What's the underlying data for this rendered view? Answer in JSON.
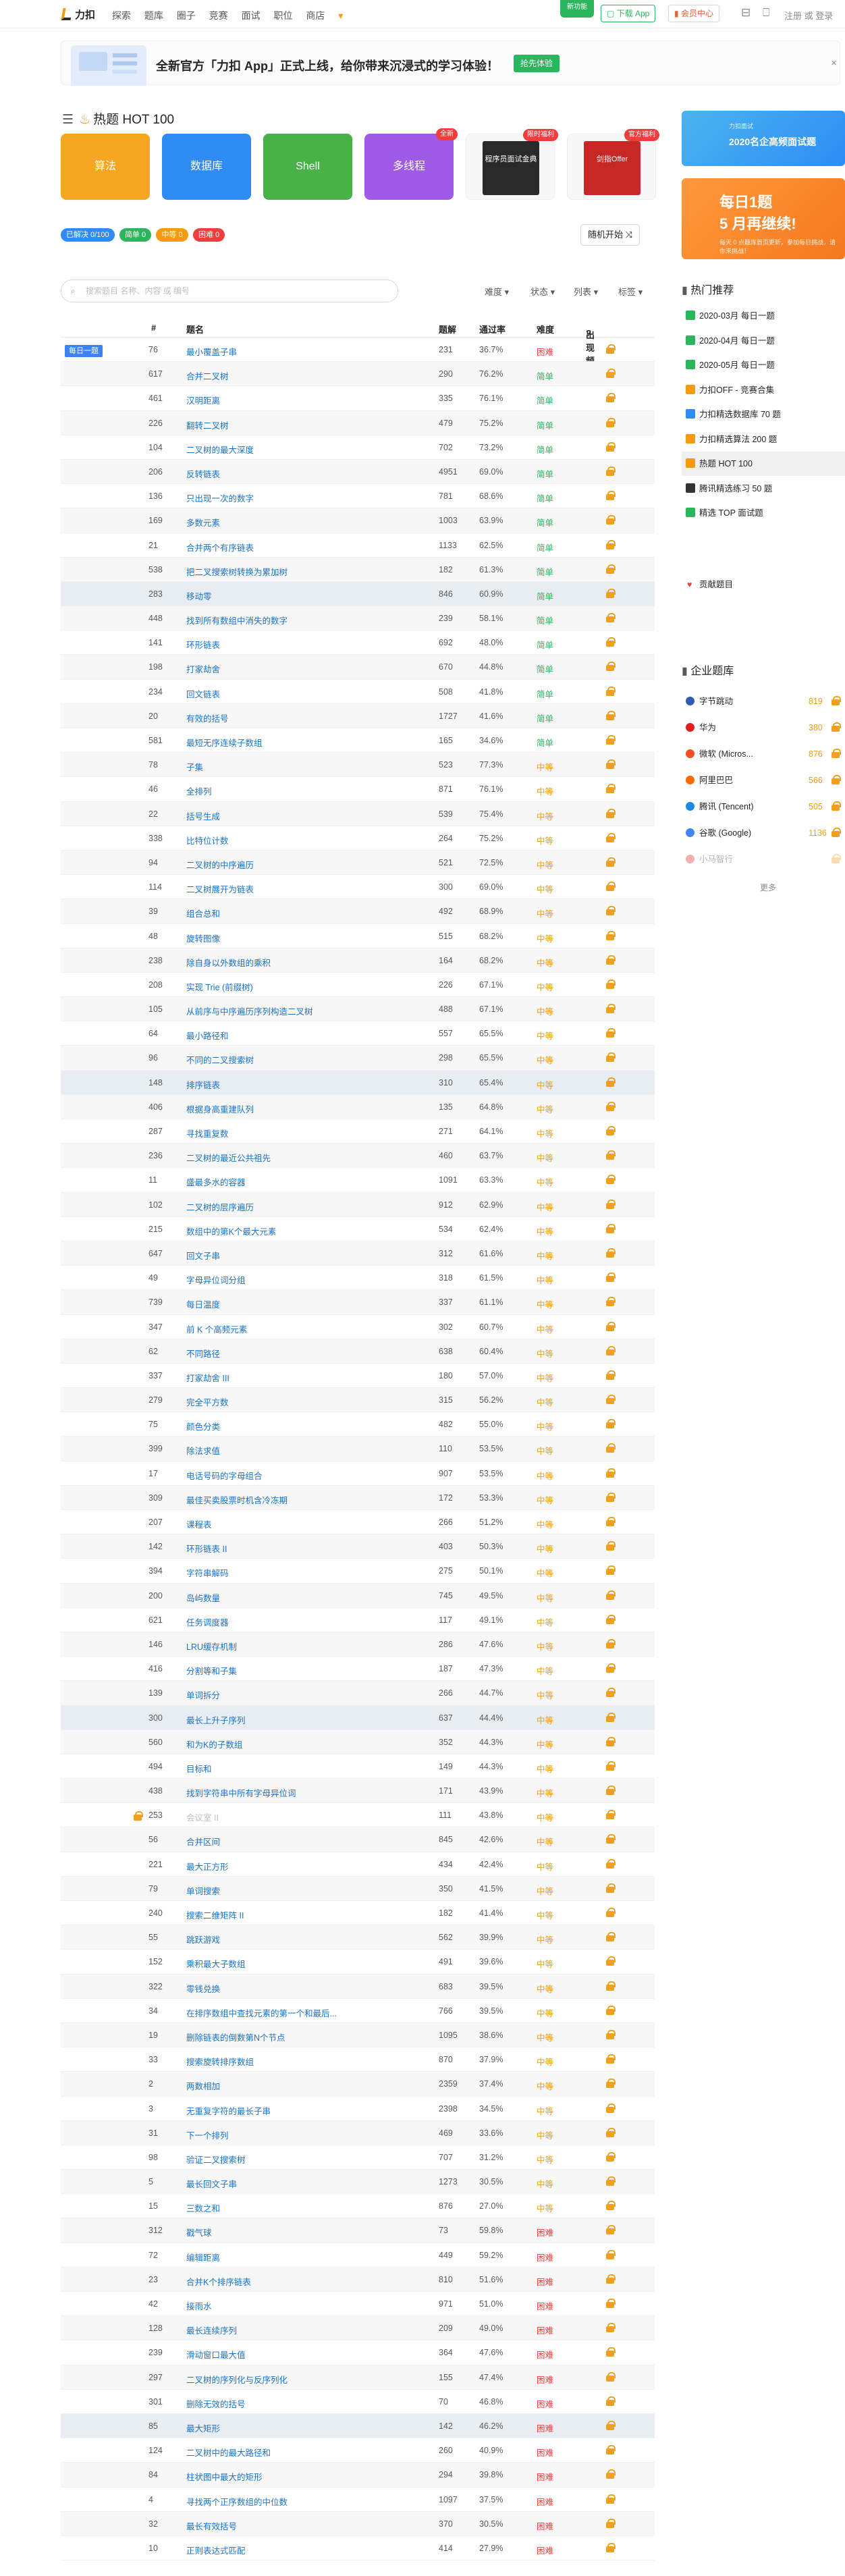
{
  "nav": {
    "logo": "力扣",
    "links": [
      "探索",
      "题库",
      "圈子",
      "竞赛",
      "面试",
      "职位",
      "商店"
    ],
    "new_badge": "新功能",
    "download_btn": "下载 App",
    "vip_btn": "会员中心",
    "register": "注册",
    "or": "或",
    "login": "登录"
  },
  "banner": {
    "text": "全新官方「力扣 App」正式上线，给你带来沉浸式的学习体验！",
    "button": "抢先体验",
    "close": "×"
  },
  "page_title": "热题 HOT 100",
  "categories": [
    {
      "label": "算法",
      "color": "#f5a623"
    },
    {
      "label": "数据库",
      "color": "#2f8cf4"
    },
    {
      "label": "Shell",
      "color": "#48b147"
    },
    {
      "label": "多线程",
      "color": "#a05be6",
      "tag": "全新"
    },
    {
      "label": "程序员面试金典",
      "color": "#f7f7f7",
      "tag": "限时福利",
      "cover": "程序员面试金典"
    },
    {
      "label": "剑指 Offer",
      "color": "#f7f7f7",
      "tag": "官方福利",
      "cover": "剑指Offer"
    }
  ],
  "stats": {
    "solved": "已解决 0/100",
    "easy": "简单 0",
    "medium": "中等 0",
    "hard": "困难 0"
  },
  "random_btn": "随机开始",
  "search_placeholder": "搜索题目 名称、内容 或 编号",
  "filters": [
    "难度",
    "状态",
    "列表",
    "标签"
  ],
  "table_headers": {
    "no": "#",
    "title": "题名",
    "solutions": "题解",
    "rate": "通过率",
    "difficulty": "难度",
    "frequency": "出现频率"
  },
  "daily_label": "每日一题",
  "problems": [
    {
      "no": "76",
      "title": "最小覆盖子串",
      "sol": "231",
      "rate": "36.7%",
      "diff": "困难"
    },
    {
      "no": "617",
      "title": "合并二叉树",
      "sol": "290",
      "rate": "76.2%",
      "diff": "简单"
    },
    {
      "no": "461",
      "title": "汉明距离",
      "sol": "335",
      "rate": "76.1%",
      "diff": "简单"
    },
    {
      "no": "226",
      "title": "翻转二叉树",
      "sol": "479",
      "rate": "75.2%",
      "diff": "简单"
    },
    {
      "no": "104",
      "title": "二叉树的最大深度",
      "sol": "702",
      "rate": "73.2%",
      "diff": "简单"
    },
    {
      "no": "206",
      "title": "反转链表",
      "sol": "4951",
      "rate": "69.0%",
      "diff": "简单"
    },
    {
      "no": "136",
      "title": "只出现一次的数字",
      "sol": "781",
      "rate": "68.6%",
      "diff": "简单"
    },
    {
      "no": "169",
      "title": "多数元素",
      "sol": "1003",
      "rate": "63.9%",
      "diff": "简单"
    },
    {
      "no": "21",
      "title": "合并两个有序链表",
      "sol": "1133",
      "rate": "62.5%",
      "diff": "简单"
    },
    {
      "no": "538",
      "title": "把二叉搜索树转换为累加树",
      "sol": "182",
      "rate": "61.3%",
      "diff": "简单"
    },
    {
      "no": "283",
      "title": "移动零",
      "sol": "846",
      "rate": "60.9%",
      "diff": "简单"
    },
    {
      "no": "448",
      "title": "找到所有数组中消失的数字",
      "sol": "239",
      "rate": "58.1%",
      "diff": "简单"
    },
    {
      "no": "141",
      "title": "环形链表",
      "sol": "692",
      "rate": "48.0%",
      "diff": "简单"
    },
    {
      "no": "198",
      "title": "打家劫舍",
      "sol": "670",
      "rate": "44.8%",
      "diff": "简单"
    },
    {
      "no": "234",
      "title": "回文链表",
      "sol": "508",
      "rate": "41.8%",
      "diff": "简单"
    },
    {
      "no": "20",
      "title": "有效的括号",
      "sol": "1727",
      "rate": "41.6%",
      "diff": "简单"
    },
    {
      "no": "581",
      "title": "最短无序连续子数组",
      "sol": "165",
      "rate": "34.6%",
      "diff": "简单"
    },
    {
      "no": "78",
      "title": "子集",
      "sol": "523",
      "rate": "77.3%",
      "diff": "中等"
    },
    {
      "no": "46",
      "title": "全排列",
      "sol": "871",
      "rate": "76.1%",
      "diff": "中等"
    },
    {
      "no": "22",
      "title": "括号生成",
      "sol": "539",
      "rate": "75.4%",
      "diff": "中等"
    },
    {
      "no": "338",
      "title": "比特位计数",
      "sol": "264",
      "rate": "75.2%",
      "diff": "中等"
    },
    {
      "no": "94",
      "title": "二叉树的中序遍历",
      "sol": "521",
      "rate": "72.5%",
      "diff": "中等"
    },
    {
      "no": "114",
      "title": "二叉树展开为链表",
      "sol": "300",
      "rate": "69.0%",
      "diff": "中等"
    },
    {
      "no": "39",
      "title": "组合总和",
      "sol": "492",
      "rate": "68.9%",
      "diff": "中等"
    },
    {
      "no": "48",
      "title": "旋转图像",
      "sol": "515",
      "rate": "68.2%",
      "diff": "中等"
    },
    {
      "no": "238",
      "title": "除自身以外数组的乘积",
      "sol": "164",
      "rate": "68.2%",
      "diff": "中等"
    },
    {
      "no": "208",
      "title": "实现 Trie (前缀树)",
      "sol": "226",
      "rate": "67.1%",
      "diff": "中等"
    },
    {
      "no": "105",
      "title": "从前序与中序遍历序列构造二叉树",
      "sol": "488",
      "rate": "67.1%",
      "diff": "中等"
    },
    {
      "no": "64",
      "title": "最小路径和",
      "sol": "557",
      "rate": "65.5%",
      "diff": "中等"
    },
    {
      "no": "96",
      "title": "不同的二叉搜索树",
      "sol": "298",
      "rate": "65.5%",
      "diff": "中等"
    },
    {
      "no": "148",
      "title": "排序链表",
      "sol": "310",
      "rate": "65.4%",
      "diff": "中等"
    },
    {
      "no": "406",
      "title": "根据身高重建队列",
      "sol": "135",
      "rate": "64.8%",
      "diff": "中等"
    },
    {
      "no": "287",
      "title": "寻找重复数",
      "sol": "271",
      "rate": "64.1%",
      "diff": "中等"
    },
    {
      "no": "236",
      "title": "二叉树的最近公共祖先",
      "sol": "460",
      "rate": "63.7%",
      "diff": "中等"
    },
    {
      "no": "11",
      "title": "盛最多水的容器",
      "sol": "1091",
      "rate": "63.3%",
      "diff": "中等"
    },
    {
      "no": "102",
      "title": "二叉树的层序遍历",
      "sol": "912",
      "rate": "62.9%",
      "diff": "中等"
    },
    {
      "no": "215",
      "title": "数组中的第K个最大元素",
      "sol": "534",
      "rate": "62.4%",
      "diff": "中等"
    },
    {
      "no": "647",
      "title": "回文子串",
      "sol": "312",
      "rate": "61.6%",
      "diff": "中等"
    },
    {
      "no": "49",
      "title": "字母异位词分组",
      "sol": "318",
      "rate": "61.5%",
      "diff": "中等"
    },
    {
      "no": "739",
      "title": "每日温度",
      "sol": "337",
      "rate": "61.1%",
      "diff": "中等"
    },
    {
      "no": "347",
      "title": "前 K 个高频元素",
      "sol": "302",
      "rate": "60.7%",
      "diff": "中等"
    },
    {
      "no": "62",
      "title": "不同路径",
      "sol": "638",
      "rate": "60.4%",
      "diff": "中等"
    },
    {
      "no": "337",
      "title": "打家劫舍 III",
      "sol": "180",
      "rate": "57.0%",
      "diff": "中等"
    },
    {
      "no": "279",
      "title": "完全平方数",
      "sol": "315",
      "rate": "56.2%",
      "diff": "中等"
    },
    {
      "no": "75",
      "title": "颜色分类",
      "sol": "482",
      "rate": "55.0%",
      "diff": "中等"
    },
    {
      "no": "399",
      "title": "除法求值",
      "sol": "110",
      "rate": "53.5%",
      "diff": "中等"
    },
    {
      "no": "17",
      "title": "电话号码的字母组合",
      "sol": "907",
      "rate": "53.5%",
      "diff": "中等"
    },
    {
      "no": "309",
      "title": "最佳买卖股票时机含冷冻期",
      "sol": "172",
      "rate": "53.3%",
      "diff": "中等"
    },
    {
      "no": "207",
      "title": "课程表",
      "sol": "266",
      "rate": "51.2%",
      "diff": "中等"
    },
    {
      "no": "142",
      "title": "环形链表 II",
      "sol": "403",
      "rate": "50.3%",
      "diff": "中等"
    },
    {
      "no": "394",
      "title": "字符串解码",
      "sol": "275",
      "rate": "50.1%",
      "diff": "中等"
    },
    {
      "no": "200",
      "title": "岛屿数量",
      "sol": "745",
      "rate": "49.5%",
      "diff": "中等"
    },
    {
      "no": "621",
      "title": "任务调度器",
      "sol": "117",
      "rate": "49.1%",
      "diff": "中等"
    },
    {
      "no": "146",
      "title": "LRU缓存机制",
      "sol": "286",
      "rate": "47.6%",
      "diff": "中等"
    },
    {
      "no": "416",
      "title": "分割等和子集",
      "sol": "187",
      "rate": "47.3%",
      "diff": "中等"
    },
    {
      "no": "139",
      "title": "单词拆分",
      "sol": "266",
      "rate": "44.7%",
      "diff": "中等"
    },
    {
      "no": "300",
      "title": "最长上升子序列",
      "sol": "637",
      "rate": "44.4%",
      "diff": "中等"
    },
    {
      "no": "560",
      "title": "和为K的子数组",
      "sol": "352",
      "rate": "44.3%",
      "diff": "中等"
    },
    {
      "no": "494",
      "title": "目标和",
      "sol": "149",
      "rate": "44.3%",
      "diff": "中等"
    },
    {
      "no": "438",
      "title": "找到字符串中所有字母异位词",
      "sol": "171",
      "rate": "43.9%",
      "diff": "中等"
    },
    {
      "no": "253",
      "title": "会议室 II",
      "sol": "111",
      "rate": "43.8%",
      "diff": "中等",
      "locked": true
    },
    {
      "no": "56",
      "title": "合并区间",
      "sol": "845",
      "rate": "42.6%",
      "diff": "中等"
    },
    {
      "no": "221",
      "title": "最大正方形",
      "sol": "434",
      "rate": "42.4%",
      "diff": "中等"
    },
    {
      "no": "79",
      "title": "单词搜索",
      "sol": "350",
      "rate": "41.5%",
      "diff": "中等"
    },
    {
      "no": "240",
      "title": "搜索二维矩阵 II",
      "sol": "182",
      "rate": "41.4%",
      "diff": "中等"
    },
    {
      "no": "55",
      "title": "跳跃游戏",
      "sol": "562",
      "rate": "39.9%",
      "diff": "中等"
    },
    {
      "no": "152",
      "title": "乘积最大子数组",
      "sol": "491",
      "rate": "39.6%",
      "diff": "中等"
    },
    {
      "no": "322",
      "title": "零钱兑换",
      "sol": "683",
      "rate": "39.5%",
      "diff": "中等"
    },
    {
      "no": "34",
      "title": "在排序数组中查找元素的第一个和最后...",
      "sol": "766",
      "rate": "39.5%",
      "diff": "中等"
    },
    {
      "no": "19",
      "title": "删除链表的倒数第N个节点",
      "sol": "1095",
      "rate": "38.6%",
      "diff": "中等"
    },
    {
      "no": "33",
      "title": "搜索旋转排序数组",
      "sol": "870",
      "rate": "37.9%",
      "diff": "中等"
    },
    {
      "no": "2",
      "title": "两数相加",
      "sol": "2359",
      "rate": "37.4%",
      "diff": "中等"
    },
    {
      "no": "3",
      "title": "无重复字符的最长子串",
      "sol": "2398",
      "rate": "34.5%",
      "diff": "中等"
    },
    {
      "no": "31",
      "title": "下一个排列",
      "sol": "469",
      "rate": "33.6%",
      "diff": "中等"
    },
    {
      "no": "98",
      "title": "验证二叉搜索树",
      "sol": "707",
      "rate": "31.2%",
      "diff": "中等"
    },
    {
      "no": "5",
      "title": "最长回文子串",
      "sol": "1273",
      "rate": "30.5%",
      "diff": "中等"
    },
    {
      "no": "15",
      "title": "三数之和",
      "sol": "876",
      "rate": "27.0%",
      "diff": "中等"
    },
    {
      "no": "312",
      "title": "戳气球",
      "sol": "73",
      "rate": "59.8%",
      "diff": "困难"
    },
    {
      "no": "72",
      "title": "编辑距离",
      "sol": "449",
      "rate": "59.2%",
      "diff": "困难"
    },
    {
      "no": "23",
      "title": "合并K个排序链表",
      "sol": "810",
      "rate": "51.6%",
      "diff": "困难"
    },
    {
      "no": "42",
      "title": "接雨水",
      "sol": "971",
      "rate": "51.0%",
      "diff": "困难"
    },
    {
      "no": "128",
      "title": "最长连续序列",
      "sol": "209",
      "rate": "49.0%",
      "diff": "困难"
    },
    {
      "no": "239",
      "title": "滑动窗口最大值",
      "sol": "364",
      "rate": "47.6%",
      "diff": "困难"
    },
    {
      "no": "297",
      "title": "二叉树的序列化与反序列化",
      "sol": "155",
      "rate": "47.4%",
      "diff": "困难"
    },
    {
      "no": "301",
      "title": "删除无效的括号",
      "sol": "70",
      "rate": "46.8%",
      "diff": "困难"
    },
    {
      "no": "85",
      "title": "最大矩形",
      "sol": "142",
      "rate": "46.2%",
      "diff": "困难"
    },
    {
      "no": "124",
      "title": "二叉树中的最大路径和",
      "sol": "260",
      "rate": "40.9%",
      "diff": "困难"
    },
    {
      "no": "84",
      "title": "柱状图中最大的矩形",
      "sol": "294",
      "rate": "39.8%",
      "diff": "困难"
    },
    {
      "no": "4",
      "title": "寻找两个正序数组的中位数",
      "sol": "1097",
      "rate": "37.5%",
      "diff": "困难"
    },
    {
      "no": "32",
      "title": "最长有效括号",
      "sol": "370",
      "rate": "30.5%",
      "diff": "困难"
    },
    {
      "no": "10",
      "title": "正则表达式匹配",
      "sol": "414",
      "rate": "27.9%",
      "diff": "困难"
    }
  ],
  "sidebar": {
    "ad1": {
      "label": "2020名企高频面试题",
      "tag": "力扣面试"
    },
    "ad2": {
      "line1": "每日1题",
      "line2": "5 月再继续!",
      "sub": "每天 0 点题库首页更新，参加每日挑战，请你来挑战！"
    },
    "hot_title": "热门推荐",
    "hot_items": [
      {
        "label": "2020-03月 每日一题",
        "color": "#2db55d"
      },
      {
        "label": "2020-04月 每日一题",
        "color": "#2db55d"
      },
      {
        "label": "2020-05月 每日一题",
        "color": "#2db55d"
      },
      {
        "label": "力扣OFF - 竞赛合集",
        "color": "#f39c12"
      },
      {
        "label": "力扣精选数据库 70 题",
        "color": "#2f8cf4"
      },
      {
        "label": "力扣精选算法 200 题",
        "color": "#f39c12"
      },
      {
        "label": "热题 HOT 100",
        "color": "#f39c12",
        "active": true
      },
      {
        "label": "腾讯精选练习 50 题",
        "color": "#333333"
      },
      {
        "label": "精选 TOP 面试题",
        "color": "#2db55d"
      }
    ],
    "contribute": "贡献题目",
    "company_title": "企业题库",
    "companies": [
      {
        "name": "字节跳动",
        "count": "819",
        "color": "#325ab4"
      },
      {
        "name": "华为",
        "count": "380",
        "color": "#e02020"
      },
      {
        "name": "微软 (Micros...",
        "count": "876",
        "color": "#f25022"
      },
      {
        "name": "阿里巴巴",
        "count": "566",
        "color": "#ff6a00"
      },
      {
        "name": "腾讯 (Tencent)",
        "count": "505",
        "color": "#1e88e5"
      },
      {
        "name": "谷歌 (Google)",
        "count": "1136",
        "color": "#4285f4"
      },
      {
        "name": "小马智行",
        "count": "",
        "color": "#e02020"
      }
    ],
    "more": "更多"
  }
}
